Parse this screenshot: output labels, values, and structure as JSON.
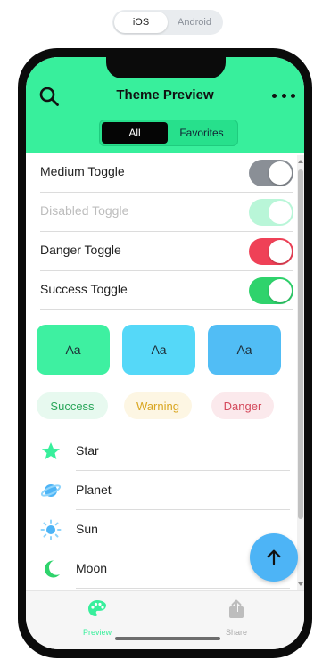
{
  "platform_switch": {
    "options": [
      "iOS",
      "Android"
    ],
    "selected": "iOS"
  },
  "header": {
    "title": "Theme Preview",
    "tabs": [
      "All",
      "Favorites"
    ],
    "active_tab": "All"
  },
  "toggles": [
    {
      "label": "Medium Toggle",
      "color": "#8a8f96",
      "on": true,
      "disabled": false
    },
    {
      "label": "Disabled Toggle",
      "color": "#b9f6d8",
      "on": true,
      "disabled": true
    },
    {
      "label": "Danger Toggle",
      "color": "#ef4157",
      "on": true,
      "disabled": false
    },
    {
      "label": "Success Toggle",
      "color": "#2fd36c",
      "on": true,
      "disabled": false
    }
  ],
  "swatches": [
    {
      "label": "Aa",
      "color": "#3ef0a1"
    },
    {
      "label": "Aa",
      "color": "#55d8f8"
    },
    {
      "label": "Aa",
      "color": "#51bdf5"
    }
  ],
  "chips": [
    {
      "label": "Success",
      "bg": "#e7f9ef",
      "fg": "#2aa65a"
    },
    {
      "label": "Warning",
      "bg": "#fdf6e3",
      "fg": "#d9a620"
    },
    {
      "label": "Danger",
      "bg": "#fbe9ec",
      "fg": "#d4495c"
    }
  ],
  "list": [
    {
      "label": "Star",
      "icon": "star-icon"
    },
    {
      "label": "Planet",
      "icon": "planet-icon"
    },
    {
      "label": "Sun",
      "icon": "sun-icon"
    },
    {
      "label": "Moon",
      "icon": "moon-icon"
    }
  ],
  "tabbar": [
    {
      "label": "Preview",
      "icon": "palette-icon",
      "active": true
    },
    {
      "label": "Share",
      "icon": "share-icon",
      "active": false
    }
  ],
  "colors": {
    "primary": "#38ef9c",
    "fab": "#4db4f6",
    "inactive": "#aaaaaa"
  }
}
